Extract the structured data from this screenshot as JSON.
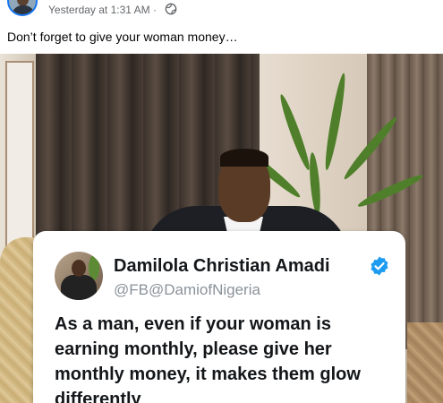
{
  "post": {
    "timestamp": "Yesterday at 1:31 AM ·",
    "privacy_icon": "globe-icon",
    "caption": "Don’t forget to give your woman money…"
  },
  "tweet": {
    "author_name": "Damilola Christian Amadi",
    "handle": "@FB@DamiofNigeria",
    "verified_icon": "verified-badge-icon",
    "verified_color": "#1d9bf0",
    "text": "As a man, even if your woman is earning monthly, please give her monthly money, it makes them glow differently"
  }
}
